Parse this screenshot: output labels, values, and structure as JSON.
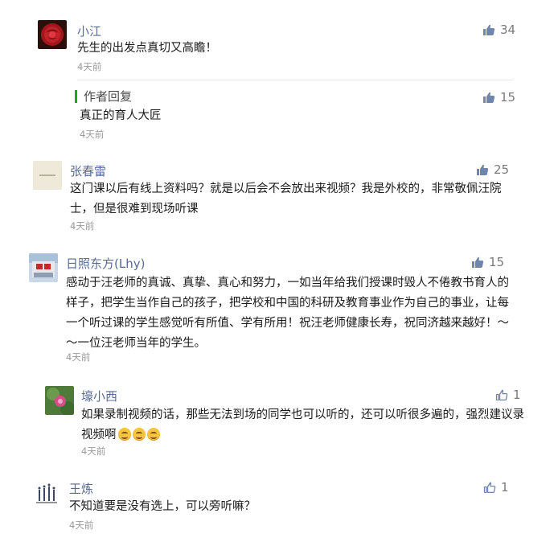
{
  "comments": [
    {
      "name": "小江",
      "likes": "34",
      "text": "先生的出发点真切又高瞻！",
      "time": "4天前",
      "reply": {
        "label": "作者回复",
        "likes": "15",
        "text": "真正的育人大匠",
        "time": "4天前"
      }
    },
    {
      "name": "张春雷",
      "likes": "25",
      "text": "这门课以后有线上资料吗？就是以后会不会放出来视频？我是外校的，非常敬佩汪院士，但是很难到现场听课",
      "time": "4天前"
    },
    {
      "name": "日照东方(Lhy)",
      "likes": "15",
      "text": "感动于汪老师的真诚、真挚、真心和努力，一如当年给我们授课时毁人不倦教书育人的样子，把学生当作自己的孩子，把学校和中国的科研及教育事业作为自己的事业，让每一个听过课的学生感觉听有所值、学有所用！祝汪老师健康长寿，祝同济越来越好！～～一位汪老师当年的学生。",
      "time": "4天前"
    },
    {
      "name": "壕小西",
      "likes": "1",
      "text": "如果录制视频的话，那些无法到场的同学也可以听的，还可以听很多遍的，强烈建议录视频啊",
      "time": "4天前"
    },
    {
      "name": "王炼",
      "likes": "1",
      "text": "不知道要是没有选上，可以旁听嘛？",
      "time": "4天前"
    }
  ],
  "icons": {
    "like": "thumbs-up-icon"
  }
}
